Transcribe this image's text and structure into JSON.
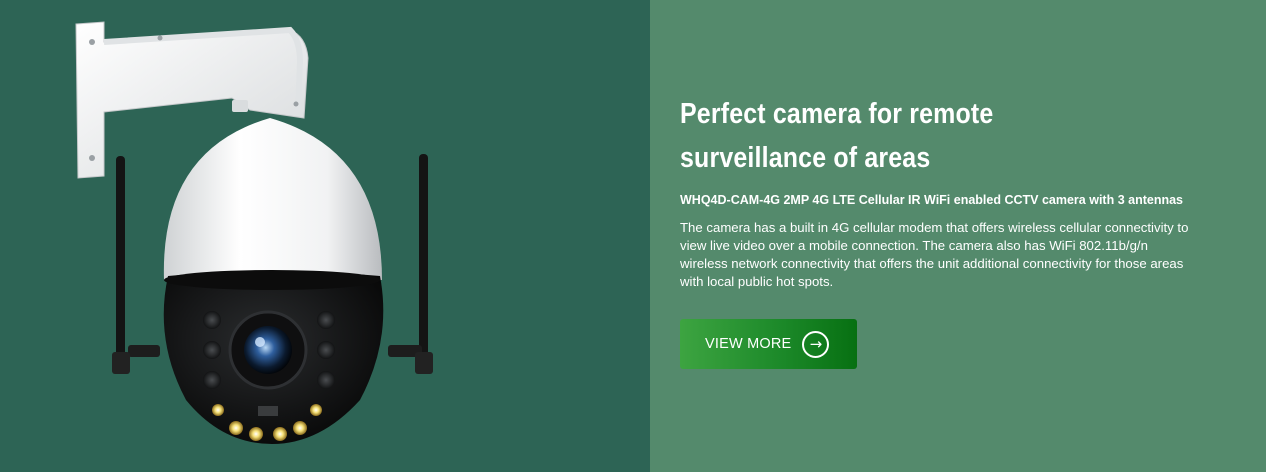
{
  "banner": {
    "title": "Perfect camera for remote surveillance of areas",
    "subtitle": "WHQ4D-CAM-4G 2MP 4G LTE Cellular IR WiFi enabled CCTV camera with 3 antennas",
    "description": "The camera has a built in 4G cellular modem that offers wireless cellular connectivity to view live video over a mobile connection. The camera also has WiFi 802.11b/g/n wireless network connectivity that offers the unit additional connectivity for those areas with local public hot spots.",
    "button_label": "VIEW MORE",
    "button_icon": "arrow-right-circle-icon"
  },
  "colors": {
    "left_panel": "#2d6455",
    "right_panel": "#548a6c",
    "button_start": "#3da441",
    "button_end": "#077012"
  }
}
